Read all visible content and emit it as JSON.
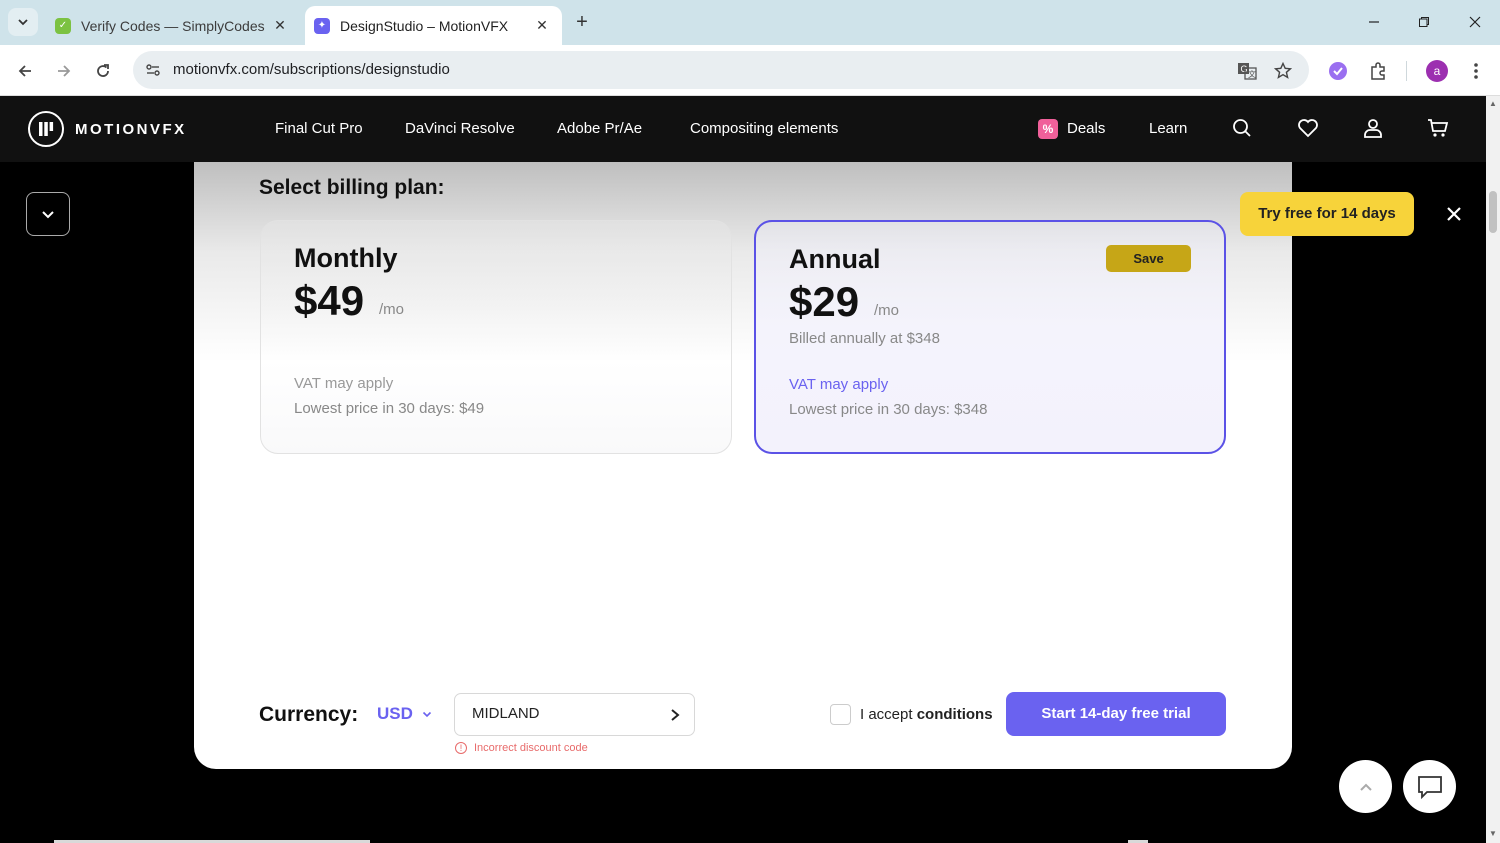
{
  "browser": {
    "tabs": [
      {
        "title": "Verify Codes — SimplyCodes",
        "active": false
      },
      {
        "title": "DesignStudio – MotionVFX",
        "active": true
      }
    ],
    "url": "motionvfx.com/subscriptions/designstudio",
    "profile_initial": "a"
  },
  "header": {
    "logo_text": "MOTIONVFX",
    "nav": [
      "Final Cut Pro",
      "DaVinci Resolve",
      "Adobe Pr/Ae",
      "Compositing elements"
    ],
    "deals_label": "Deals",
    "learn_label": "Learn"
  },
  "modal": {
    "title": "Select billing plan:",
    "plans": [
      {
        "name": "Monthly",
        "price": "$49",
        "per": "/mo",
        "billed": "",
        "vat": "VAT may apply",
        "lowest": "Lowest price in 30 days: $49",
        "selected": false
      },
      {
        "name": "Annual",
        "price": "$29",
        "per": "/mo",
        "badge": "Save",
        "billed": "Billed annually at $348",
        "vat": "VAT may apply",
        "lowest": "Lowest price in 30 days: $348",
        "selected": true
      }
    ],
    "currency_label": "Currency:",
    "currency_value": "USD",
    "discount_value": "MIDLAND",
    "discount_error": "Incorrect discount code",
    "accept_prefix": "I accept",
    "accept_link": "conditions",
    "cta_label": "Start 14-day free trial"
  },
  "promo": {
    "try_free_label": "Try free for 14 days"
  },
  "colors": {
    "accent": "#6a62f0",
    "save_badge": "#c6a617",
    "try_free": "#f7d33a",
    "error": "#e86b6b",
    "deals_icon": "#f0609a"
  }
}
